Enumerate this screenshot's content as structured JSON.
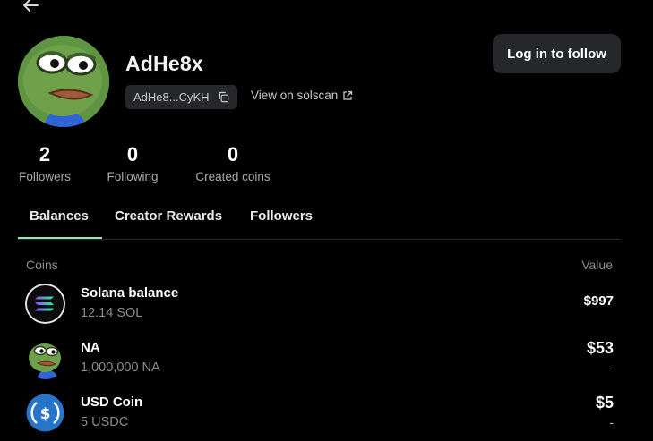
{
  "profile": {
    "username": "AdHe8x",
    "address_short": "AdHe8...CyKH",
    "solscan_label": "View on solscan",
    "follow_label": "Log in to follow"
  },
  "stats": [
    {
      "value": "2",
      "label": "Followers"
    },
    {
      "value": "0",
      "label": "Following"
    },
    {
      "value": "0",
      "label": "Created coins"
    }
  ],
  "tabs": [
    {
      "label": "Balances",
      "active": true
    },
    {
      "label": "Creator Rewards"
    },
    {
      "label": "Followers"
    }
  ],
  "table": {
    "col_coins": "Coins",
    "col_value": "Value",
    "rows": [
      {
        "name": "Solana balance",
        "amount": "12.14 SOL",
        "value": "$997",
        "icon": "solana-icon"
      },
      {
        "name": "NA",
        "amount": "1,000,000 NA",
        "value": "$53",
        "sub": "-",
        "icon": "pepe-token-icon"
      },
      {
        "name": "USD Coin",
        "amount": "5 USDC",
        "value": "$5",
        "sub": "-",
        "icon": "usdc-icon"
      }
    ]
  },
  "colors": {
    "background": "#000000",
    "accent": "#86efac",
    "chip": "#26272b"
  }
}
